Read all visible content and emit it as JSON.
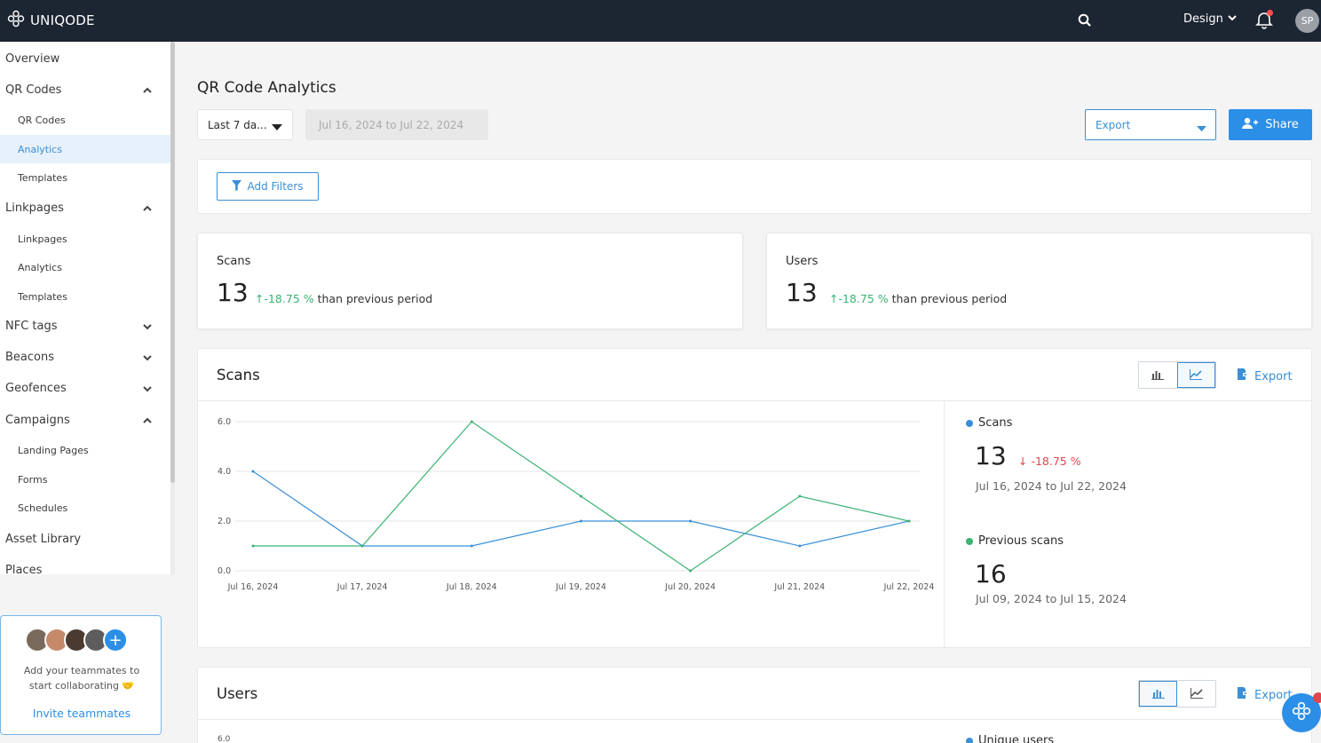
{
  "topbar": {
    "brand": "UNIQODE",
    "design_label": "Design",
    "avatar_initials": "SP"
  },
  "sidebar": {
    "items": [
      {
        "label": "Overview"
      },
      {
        "label": "QR Codes"
      },
      {
        "label": "QR Codes"
      },
      {
        "label": "Analytics"
      },
      {
        "label": "Templates"
      },
      {
        "label": "Linkpages"
      },
      {
        "label": "Linkpages"
      },
      {
        "label": "Analytics"
      },
      {
        "label": "Templates"
      },
      {
        "label": "NFC tags"
      },
      {
        "label": "Beacons"
      },
      {
        "label": "Geofences"
      },
      {
        "label": "Campaigns"
      },
      {
        "label": "Landing Pages"
      },
      {
        "label": "Forms"
      },
      {
        "label": "Schedules"
      },
      {
        "label": "Asset Library"
      },
      {
        "label": "Places"
      }
    ],
    "team": {
      "text_line1": "Add your teammates to",
      "text_line2": "start collaborating 🤝",
      "invite_label": "Invite teammates",
      "plus": "+"
    }
  },
  "header": {
    "title": "QR Code Analytics",
    "range_select": "Last 7 da...",
    "date_range": "Jul 16, 2024 to Jul 22, 2024",
    "export_label": "Export",
    "share_label": "Share"
  },
  "filters": {
    "add_filters_label": "Add Filters"
  },
  "stats": [
    {
      "label": "Scans",
      "value": "13",
      "change": "↑-18.75 %",
      "note": "than previous period"
    },
    {
      "label": "Users",
      "value": "13",
      "change": "↑-18.75 %",
      "note": "than previous period"
    }
  ],
  "scans_card": {
    "title": "Scans",
    "export_label": "Export",
    "current": {
      "legend": "Scans",
      "value": "13",
      "change": "↓ -18.75 %",
      "range": "Jul 16, 2024 to Jul 22, 2024"
    },
    "previous": {
      "legend": "Previous scans",
      "value": "16",
      "range": "Jul 09, 2024 to Jul 15, 2024"
    }
  },
  "users_card": {
    "title": "Users",
    "export_label": "Export",
    "legend": "Unique users",
    "axis_top": "6.0"
  },
  "colors": {
    "current_series": "#3a8fd6",
    "previous_series": "#3bb273",
    "accent": "#2b8fe8"
  },
  "chart_data": {
    "type": "line",
    "categories": [
      "Jul 16, 2024",
      "Jul 17, 2024",
      "Jul 18, 2024",
      "Jul 19, 2024",
      "Jul 20, 2024",
      "Jul 21, 2024",
      "Jul 22, 2024"
    ],
    "yticks": [
      "0.0",
      "2.0",
      "4.0",
      "6.0"
    ],
    "ylim": [
      0,
      6
    ],
    "series": [
      {
        "name": "Scans",
        "color": "#3a8fd6",
        "values": [
          4,
          1,
          1,
          2,
          2,
          1,
          2
        ]
      },
      {
        "name": "Previous scans",
        "color": "#3bb273",
        "values": [
          1,
          1,
          6,
          3,
          0,
          3,
          2
        ]
      }
    ],
    "grid": true
  }
}
